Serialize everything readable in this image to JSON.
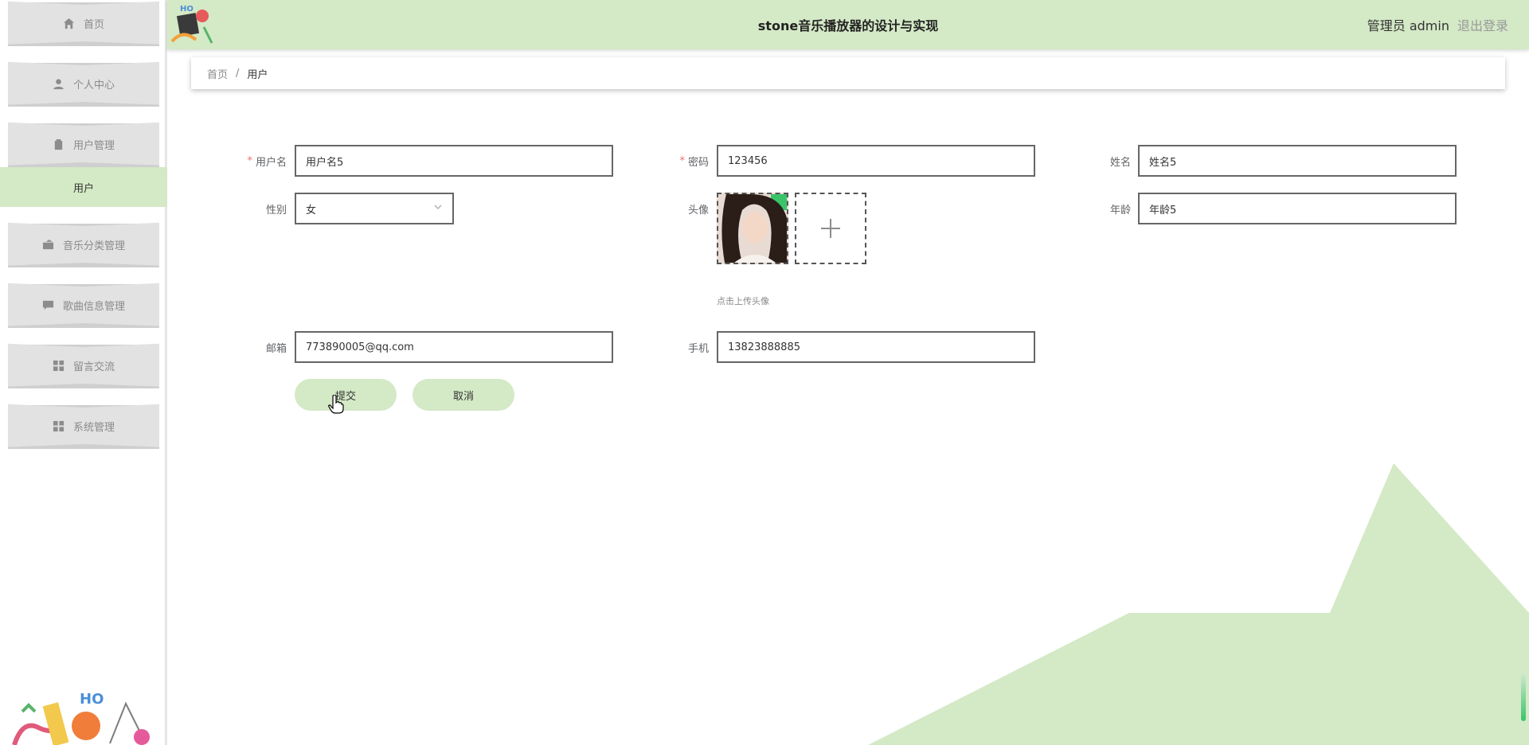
{
  "header": {
    "title": "stone音乐播放器的设计与实现",
    "user_label": "管理员 admin",
    "logout_label": "退出登录",
    "bg_color": "#d4e9c6"
  },
  "sidebar": {
    "items": [
      {
        "label": "首页",
        "icon": "home-icon"
      },
      {
        "label": "个人中心",
        "icon": "user-icon"
      },
      {
        "label": "用户管理",
        "icon": "clipboard-icon"
      },
      {
        "label": "音乐分类管理",
        "icon": "wallet-icon"
      },
      {
        "label": "歌曲信息管理",
        "icon": "message-icon"
      },
      {
        "label": "留言交流",
        "icon": "grid-icon"
      },
      {
        "label": "系统管理",
        "icon": "grid-icon"
      }
    ],
    "active_subitem": "用户"
  },
  "breadcrumb": {
    "home": "首页",
    "separator": "/",
    "current": "用户"
  },
  "form": {
    "username": {
      "label": "用户名",
      "value": "用户名5",
      "required": true
    },
    "password": {
      "label": "密码",
      "value": "123456",
      "required": true
    },
    "name": {
      "label": "姓名",
      "value": "姓名5",
      "required": false
    },
    "gender": {
      "label": "性别",
      "value": "女",
      "required": false
    },
    "avatar": {
      "label": "头像",
      "hint": "点击上传头像",
      "required": false
    },
    "age": {
      "label": "年龄",
      "value": "年龄5",
      "required": false
    },
    "email": {
      "label": "邮箱",
      "value": "773890005@qq.com",
      "required": false
    },
    "phone": {
      "label": "手机",
      "value": "13823888885",
      "required": false
    },
    "submit_label": "提交",
    "cancel_label": "取消",
    "required_mark": "*"
  },
  "colors": {
    "accent": "#d4e9c6",
    "required": "#f56c6c"
  }
}
